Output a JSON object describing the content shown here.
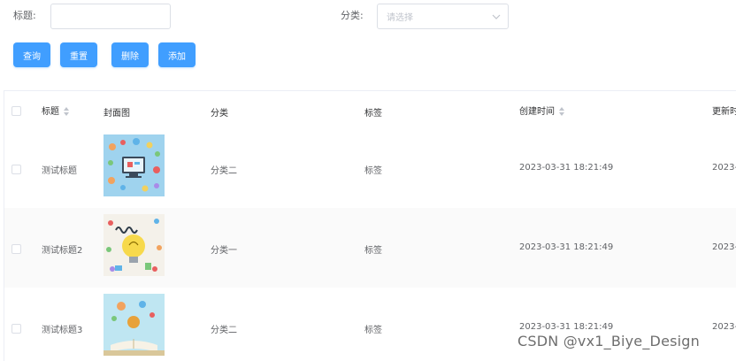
{
  "filters": {
    "title_label": "标题:",
    "title_value": "",
    "category_label": "分类:",
    "category_placeholder": "请选择"
  },
  "actions": {
    "query": "查询",
    "reset": "重置",
    "delete": "删除",
    "add": "添加"
  },
  "table": {
    "columns": {
      "title": "标题",
      "cover": "封面图",
      "category": "分类",
      "tag": "标签",
      "created": "创建时间",
      "updated": "更新时"
    },
    "rows": [
      {
        "title": "测试标题",
        "category": "分类二",
        "tag": "标签",
        "created": "2023-03-31 18:21:49",
        "updated": "2023-",
        "cover": "tech-icons-illustration"
      },
      {
        "title": "测试标题2",
        "category": "分类一",
        "tag": "标签",
        "created": "2023-03-31 18:21:49",
        "updated": "2023-",
        "cover": "learn-lightbulb-illustration"
      },
      {
        "title": "测试标题3",
        "category": "分类二",
        "tag": "标签",
        "created": "2023-03-31 18:21:49",
        "updated": "2023-",
        "cover": "open-book-illustration"
      }
    ]
  },
  "watermark": "CSDN @vx1_Biye_Design",
  "colors": {
    "primary": "#409eff",
    "border": "#dcdfe6",
    "stripe": "#fafafa"
  }
}
